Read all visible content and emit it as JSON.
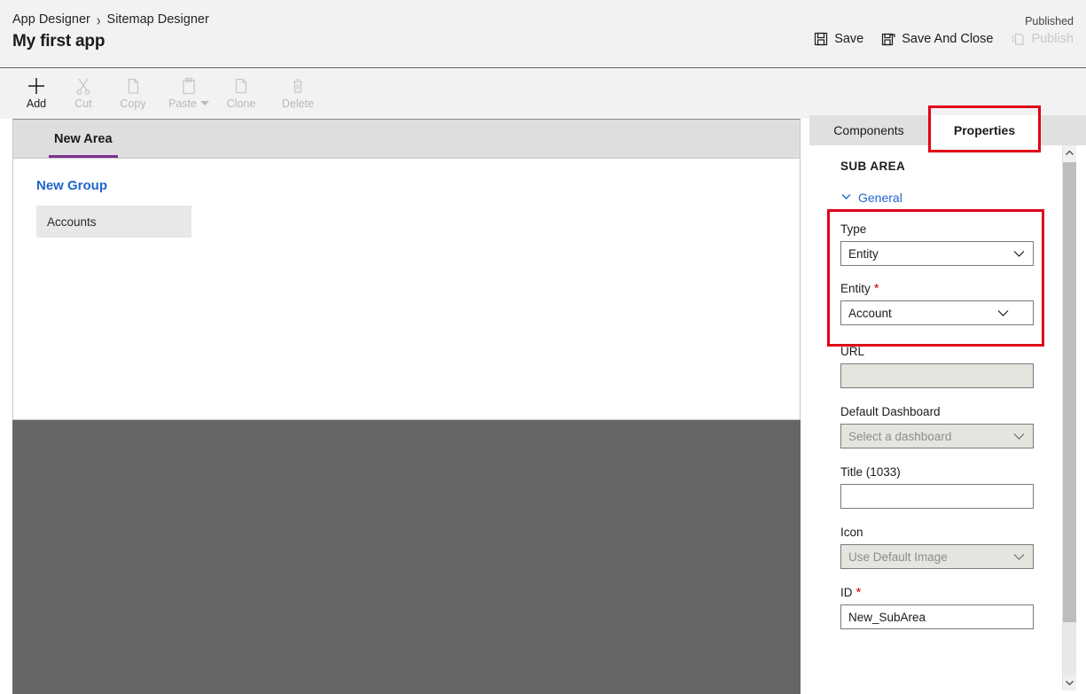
{
  "header": {
    "breadcrumb": [
      {
        "label": "App Designer"
      },
      {
        "label": "Sitemap Designer"
      }
    ],
    "breadcrumb_separator": "›",
    "app_title": "My first app",
    "publish_status": "Published",
    "actions": [
      {
        "label": "Save",
        "icon": "save-icon",
        "enabled": true
      },
      {
        "label": "Save And Close",
        "icon": "save-and-close-icon",
        "enabled": true
      },
      {
        "label": "Publish",
        "icon": "publish-icon",
        "enabled": false
      }
    ]
  },
  "toolbar": {
    "items": [
      {
        "label": "Add",
        "icon": "plus-icon",
        "enabled": true,
        "has_dropdown": false
      },
      {
        "label": "Cut",
        "icon": "scissors-icon",
        "enabled": false,
        "has_dropdown": false
      },
      {
        "label": "Copy",
        "icon": "copy-icon",
        "enabled": false,
        "has_dropdown": false
      },
      {
        "label": "Paste",
        "icon": "clipboard-icon",
        "enabled": false,
        "has_dropdown": true
      },
      {
        "label": "Clone",
        "icon": "clone-icon",
        "enabled": false,
        "has_dropdown": false
      },
      {
        "label": "Delete",
        "icon": "trash-icon",
        "enabled": false,
        "has_dropdown": false
      }
    ]
  },
  "canvas": {
    "area_tabs": [
      {
        "label": "New Area",
        "active": true
      }
    ],
    "group_title": "New Group",
    "subareas": [
      {
        "label": "Accounts",
        "selected": true
      }
    ]
  },
  "panel": {
    "tabs": [
      {
        "label": "Components",
        "active": false
      },
      {
        "label": "Properties",
        "active": true
      }
    ],
    "heading": "SUB AREA",
    "section": {
      "label": "General",
      "expanded": true,
      "icon": "chevron-down-icon"
    },
    "fields": [
      {
        "label": "Type",
        "control": "select",
        "value": "Entity",
        "required": false,
        "disabled": false,
        "icon": "chevron-down-icon"
      },
      {
        "label": "Entity",
        "control": "select",
        "value": "Account",
        "required": true,
        "disabled": false,
        "icon": "chevron-down-icon"
      },
      {
        "label": "URL",
        "control": "text",
        "value": "",
        "placeholder": "",
        "required": false,
        "disabled": true
      },
      {
        "label": "Default Dashboard",
        "control": "select",
        "value": "Select a dashboard",
        "required": false,
        "disabled": true,
        "icon": "chevron-down-icon"
      },
      {
        "label": "Title (1033)",
        "control": "text",
        "value": "",
        "placeholder": "",
        "required": false,
        "disabled": false
      },
      {
        "label": "Icon",
        "control": "select",
        "value": "Use Default Image",
        "required": false,
        "disabled": true,
        "icon": "chevron-down-icon"
      },
      {
        "label": "ID",
        "control": "text",
        "value": "New_SubArea",
        "placeholder": "",
        "required": true,
        "disabled": false
      }
    ],
    "scrollbar": {
      "up_icon": "chevron-up-icon",
      "down_icon": "chevron-down-icon"
    }
  },
  "annotations": [
    {
      "name": "properties-tab-highlight",
      "color": "#e00017"
    },
    {
      "name": "type-entity-fields-highlight",
      "color": "#e00017"
    }
  ],
  "colors": {
    "accent_purple": "#7b2f8f",
    "link_blue": "#2266cc",
    "annotation_red": "#e00017",
    "required_red": "#d40000",
    "canvas_filler": "#666666"
  }
}
